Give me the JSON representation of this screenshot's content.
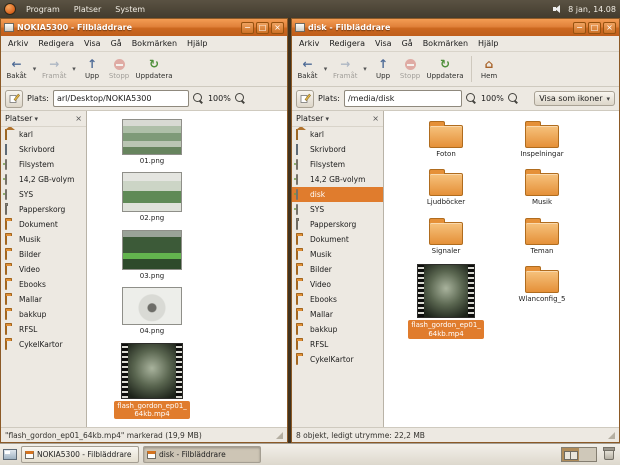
{
  "theme": {
    "accent": "#e07c2d",
    "titlebar": "#d06c1e",
    "panel_bg": "#4a4336",
    "window_bg": "#ede9e2",
    "selection": "#e07c2d"
  },
  "panel": {
    "menus": [
      "Program",
      "Platser",
      "System"
    ],
    "clock": "8 jan, 14.08"
  },
  "left_window": {
    "title": "NOKIA5300 - Filbläddrare",
    "menubar": [
      "Arkiv",
      "Redigera",
      "Visa",
      "Gå",
      "Bokmärken",
      "Hjälp"
    ],
    "toolbar": {
      "back": "Bakåt",
      "forward": "Framåt",
      "up": "Upp",
      "stop": "Stopp",
      "reload": "Uppdatera"
    },
    "location": {
      "label": "Plats:",
      "value": "arl/Desktop/NOKIA5300",
      "zoom_level": "100%"
    },
    "sidebar": {
      "header": "Platser",
      "items": [
        "karl",
        "Skrivbord",
        "Filsystem",
        "14,2 GB-volym",
        "SYS",
        "Papperskorg",
        "Dokument",
        "Musik",
        "Bilder",
        "Video",
        "Ebooks",
        "Mallar",
        "bakkup",
        "RFSL",
        "CykelKartor"
      ]
    },
    "files": [
      {
        "name": "01.png",
        "type": "image"
      },
      {
        "name": "02.png",
        "type": "image"
      },
      {
        "name": "03.png",
        "type": "image"
      },
      {
        "name": "04.png",
        "type": "image"
      },
      {
        "name": "flash_gordon_ep01_64kb.mp4",
        "type": "video",
        "selected": true
      }
    ],
    "statusbar": "\"flash_gordon_ep01_64kb.mp4\" markerad (19,9 MB)"
  },
  "right_window": {
    "title": "disk - Filbläddrare",
    "menubar": [
      "Arkiv",
      "Redigera",
      "Visa",
      "Gå",
      "Bokmärken",
      "Hjälp"
    ],
    "toolbar": {
      "back": "Bakåt",
      "forward": "Framåt",
      "up": "Upp",
      "stop": "Stopp",
      "reload": "Uppdatera",
      "home": "Hem"
    },
    "location": {
      "label": "Plats:",
      "value": "/media/disk",
      "zoom_level": "100%",
      "view_mode": "Visa som ikoner"
    },
    "sidebar": {
      "header": "Platser",
      "items": [
        "karl",
        "Skrivbord",
        "Filsystem",
        "14,2 GB-volym",
        "disk",
        "SYS",
        "Papperskorg",
        "Dokument",
        "Musik",
        "Bilder",
        "Video",
        "Ebooks",
        "Mallar",
        "bakkup",
        "RFSL",
        "CykelKartor"
      ],
      "selected": "disk"
    },
    "items": [
      {
        "name": "Foton",
        "type": "folder"
      },
      {
        "name": "Inspelningar",
        "type": "folder"
      },
      {
        "name": "Ljudböcker",
        "type": "folder"
      },
      {
        "name": "Musik",
        "type": "folder"
      },
      {
        "name": "Signaler",
        "type": "folder"
      },
      {
        "name": "Teman",
        "type": "folder"
      },
      {
        "name": "flash_gordon_ep01_64kb.mp4",
        "type": "video",
        "selected": true
      },
      {
        "name": "Wlanconfig_5",
        "type": "folder"
      }
    ],
    "statusbar": "8 objekt, ledigt utrymme: 22,2 MB"
  },
  "taskbar": {
    "windows": [
      {
        "label": "NOKIA5300 - Filbläddrare",
        "active": false
      },
      {
        "label": "disk - Filbläddrare",
        "active": true
      }
    ]
  }
}
